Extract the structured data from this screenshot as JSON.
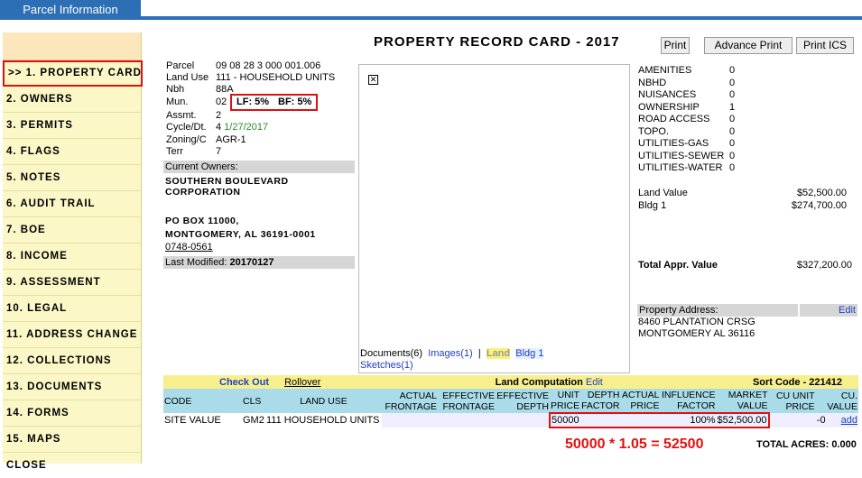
{
  "tab": {
    "label": "Parcel Information"
  },
  "sidebar": {
    "items": [
      {
        "label": ">> 1. PROPERTY CARD"
      },
      {
        "label": "2. OWNERS"
      },
      {
        "label": "3. PERMITS"
      },
      {
        "label": "4. FLAGS"
      },
      {
        "label": "5. NOTES"
      },
      {
        "label": "6. AUDIT TRAIL"
      },
      {
        "label": "7. BOE"
      },
      {
        "label": "8. INCOME"
      },
      {
        "label": "9. ASSESSMENT"
      },
      {
        "label": "10. LEGAL"
      },
      {
        "label": "11. ADDRESS CHANGE"
      },
      {
        "label": "12. COLLECTIONS"
      },
      {
        "label": "13. DOCUMENTS"
      },
      {
        "label": "14. FORMS"
      },
      {
        "label": "15. MAPS"
      },
      {
        "label": "CLOSE"
      }
    ]
  },
  "header": {
    "title": "PROPERTY RECORD CARD - 2017",
    "print": "Print",
    "advance_print": "Advance Print",
    "print_ics": "Print ICS"
  },
  "parcel": {
    "labels": [
      "Parcel",
      "Land Use",
      "Nbh",
      "Mun.",
      "Assmt.",
      "Cycle/Dt.",
      "Zoning/C",
      "Terr"
    ],
    "parcel": "09 08 28 3 000 001.006",
    "land_use": "111 - HOUSEHOLD UNITS",
    "nbh": "88A",
    "mun": "02",
    "lf": "LF: 5%",
    "bf": "BF: 5%",
    "assmt": "2",
    "cycle": "4",
    "cycle_date": "1/27/2017",
    "zoning": "AGR-1",
    "terr": "7"
  },
  "owners": {
    "header": "Current Owners:",
    "name1": "SOUTHERN BOULEVARD",
    "name2": "CORPORATION",
    "addr1": "PO BOX 11000,",
    "addr2": "MONTGOMERY, AL  36191-0001",
    "phone": "0748-0561",
    "last_modified_label": "Last Modified:",
    "last_modified": "20170127"
  },
  "docs": {
    "documents": "Documents(6)",
    "images": "Images(1)",
    "sep": "|",
    "land": "Land",
    "bldg": "Bldg 1",
    "sketches": "Sketches(1)"
  },
  "factors": [
    {
      "label": "AMENITIES",
      "value": "0"
    },
    {
      "label": "NBHD",
      "value": "0"
    },
    {
      "label": "NUISANCES",
      "value": "0"
    },
    {
      "label": "OWNERSHIP",
      "value": "1"
    },
    {
      "label": "ROAD ACCESS",
      "value": "0"
    },
    {
      "label": "TOPO.",
      "value": "0"
    },
    {
      "label": "UTILITIES-GAS",
      "value": "0"
    },
    {
      "label": "UTILITIES-SEWER",
      "value": "0"
    },
    {
      "label": "UTILITIES-WATER",
      "value": "0"
    }
  ],
  "values": {
    "land_value_label": "Land Value",
    "land_value": "$52,500.00",
    "bldg_label": "Bldg 1",
    "bldg_value": "$274,700.00",
    "total_label": "Total Appr. Value",
    "total_value": "$327,200.00"
  },
  "address": {
    "label": "Property Address:",
    "edit": "Edit",
    "line1": "8460 PLANTATION CRSG",
    "line2": "MONTGOMERY AL 36116"
  },
  "land_table": {
    "checkout": "Check Out",
    "rollover": "Rollover",
    "land_computation": "Land Computation",
    "edit": "Edit",
    "sort_code": "Sort Code - 221412",
    "headers": [
      "CODE",
      "CLS",
      "LAND USE",
      "ACTUAL FRONTAGE",
      "EFFECTIVE FRONTAGE",
      "EFFECTIVE DEPTH",
      "UNIT PRICE",
      "DEPTH FACTOR",
      "ACTUAL PRICE",
      "INFLUENCE FACTOR",
      "MARKET VALUE",
      "CU UNIT PRICE",
      "CU. VALUE"
    ],
    "row": [
      "SITE VALUE",
      "GM2",
      "111 HOUSEHOLD UNITS",
      "",
      "",
      "",
      "50000",
      "",
      "",
      "100%",
      "$52,500.00",
      "",
      "-0"
    ],
    "add": "add",
    "total_acres": "TOTAL ACRES: 0.000"
  },
  "annotation": {
    "text": "50000 * 1.05 = 52500"
  }
}
